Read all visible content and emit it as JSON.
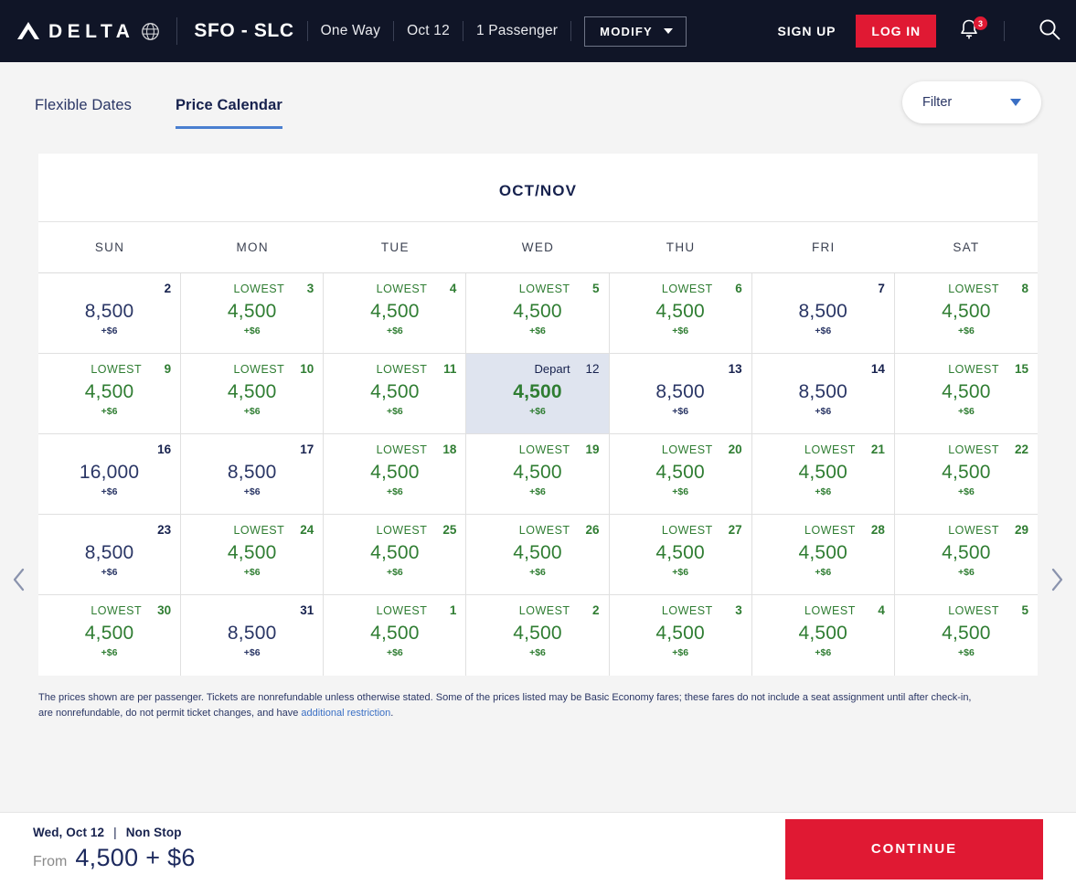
{
  "header": {
    "brand": "DELTA",
    "route": "SFO - SLC",
    "trip_type": "One Way",
    "date": "Oct 12",
    "passengers": "1 Passenger",
    "modify_label": "MODIFY",
    "sign_up_label": "SIGN UP",
    "log_in_label": "LOG IN",
    "notification_count": "3",
    "icons": {
      "globe": "globe-icon",
      "bell": "bell-icon",
      "search": "search-icon",
      "caret": "chevron-down-icon"
    },
    "colors": {
      "background": "#101527",
      "accent_red": "#e01933"
    }
  },
  "tabs": [
    {
      "label": "Flexible Dates",
      "active": false
    },
    {
      "label": "Price Calendar",
      "active": true
    }
  ],
  "filter": {
    "label": "Filter",
    "icon": "chevron-down-icon"
  },
  "calendar": {
    "title": "OCT/NOV",
    "prev_label": "chevron-left-icon",
    "next_label": "chevron-right-icon",
    "day_headers": [
      "SUN",
      "MON",
      "TUE",
      "WED",
      "THU",
      "FRI",
      "SAT"
    ],
    "lowest_tag": "LOWEST",
    "depart_tag": "Depart",
    "colors": {
      "lowest": "#2f7d32",
      "normal": "#2a3665",
      "selected_bg": "#dfe4ef"
    },
    "cells": [
      {
        "day": "2",
        "price": "8,500",
        "fee": "+$6",
        "lowest": false,
        "selected": false
      },
      {
        "day": "3",
        "price": "4,500",
        "fee": "+$6",
        "lowest": true,
        "selected": false
      },
      {
        "day": "4",
        "price": "4,500",
        "fee": "+$6",
        "lowest": true,
        "selected": false
      },
      {
        "day": "5",
        "price": "4,500",
        "fee": "+$6",
        "lowest": true,
        "selected": false
      },
      {
        "day": "6",
        "price": "4,500",
        "fee": "+$6",
        "lowest": true,
        "selected": false
      },
      {
        "day": "7",
        "price": "8,500",
        "fee": "+$6",
        "lowest": false,
        "selected": false
      },
      {
        "day": "8",
        "price": "4,500",
        "fee": "+$6",
        "lowest": true,
        "selected": false
      },
      {
        "day": "9",
        "price": "4,500",
        "fee": "+$6",
        "lowest": true,
        "selected": false
      },
      {
        "day": "10",
        "price": "4,500",
        "fee": "+$6",
        "lowest": true,
        "selected": false
      },
      {
        "day": "11",
        "price": "4,500",
        "fee": "+$6",
        "lowest": true,
        "selected": false
      },
      {
        "day": "12",
        "price": "4,500",
        "fee": "+$6",
        "lowest": false,
        "selected": true
      },
      {
        "day": "13",
        "price": "8,500",
        "fee": "+$6",
        "lowest": false,
        "selected": false
      },
      {
        "day": "14",
        "price": "8,500",
        "fee": "+$6",
        "lowest": false,
        "selected": false
      },
      {
        "day": "15",
        "price": "4,500",
        "fee": "+$6",
        "lowest": true,
        "selected": false
      },
      {
        "day": "16",
        "price": "16,000",
        "fee": "+$6",
        "lowest": false,
        "selected": false
      },
      {
        "day": "17",
        "price": "8,500",
        "fee": "+$6",
        "lowest": false,
        "selected": false
      },
      {
        "day": "18",
        "price": "4,500",
        "fee": "+$6",
        "lowest": true,
        "selected": false
      },
      {
        "day": "19",
        "price": "4,500",
        "fee": "+$6",
        "lowest": true,
        "selected": false
      },
      {
        "day": "20",
        "price": "4,500",
        "fee": "+$6",
        "lowest": true,
        "selected": false
      },
      {
        "day": "21",
        "price": "4,500",
        "fee": "+$6",
        "lowest": true,
        "selected": false
      },
      {
        "day": "22",
        "price": "4,500",
        "fee": "+$6",
        "lowest": true,
        "selected": false
      },
      {
        "day": "23",
        "price": "8,500",
        "fee": "+$6",
        "lowest": false,
        "selected": false
      },
      {
        "day": "24",
        "price": "4,500",
        "fee": "+$6",
        "lowest": true,
        "selected": false
      },
      {
        "day": "25",
        "price": "4,500",
        "fee": "+$6",
        "lowest": true,
        "selected": false
      },
      {
        "day": "26",
        "price": "4,500",
        "fee": "+$6",
        "lowest": true,
        "selected": false
      },
      {
        "day": "27",
        "price": "4,500",
        "fee": "+$6",
        "lowest": true,
        "selected": false
      },
      {
        "day": "28",
        "price": "4,500",
        "fee": "+$6",
        "lowest": true,
        "selected": false
      },
      {
        "day": "29",
        "price": "4,500",
        "fee": "+$6",
        "lowest": true,
        "selected": false
      },
      {
        "day": "30",
        "price": "4,500",
        "fee": "+$6",
        "lowest": true,
        "selected": false
      },
      {
        "day": "31",
        "price": "8,500",
        "fee": "+$6",
        "lowest": false,
        "selected": false
      },
      {
        "day": "1",
        "price": "4,500",
        "fee": "+$6",
        "lowest": true,
        "selected": false
      },
      {
        "day": "2",
        "price": "4,500",
        "fee": "+$6",
        "lowest": true,
        "selected": false
      },
      {
        "day": "3",
        "price": "4,500",
        "fee": "+$6",
        "lowest": true,
        "selected": false
      },
      {
        "day": "4",
        "price": "4,500",
        "fee": "+$6",
        "lowest": true,
        "selected": false
      },
      {
        "day": "5",
        "price": "4,500",
        "fee": "+$6",
        "lowest": true,
        "selected": false
      }
    ]
  },
  "disclaimer": {
    "text": "The prices shown are per passenger. Tickets are nonrefundable unless otherwise stated. Some of the prices listed may be Basic Economy fares; these fares do not include a seat assignment until after check-in, are nonrefundable, do not permit ticket changes, and have ",
    "link_text": "additional restriction",
    "tail": "."
  },
  "footer": {
    "date_line": "Wed, Oct 12",
    "separator": "|",
    "stops": "Non Stop",
    "from_label": "From",
    "from_price": "4,500 + $6",
    "continue_label": "CONTINUE"
  }
}
